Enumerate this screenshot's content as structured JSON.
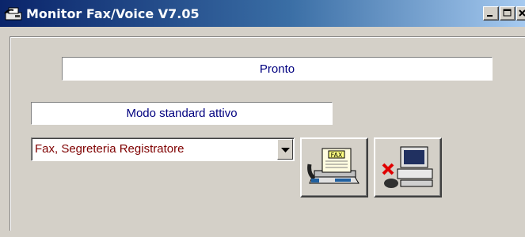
{
  "window": {
    "title": "Monitor Fax/Voice V7.05",
    "app_icon": "fax-phone-icon",
    "controls": [
      "minimize-icon",
      "maximize-icon",
      "close-icon"
    ]
  },
  "status": {
    "text": "Pronto"
  },
  "mode": {
    "text": "Modo standard attivo"
  },
  "mode_select": {
    "value": "Fax, Segreteria Registratore",
    "icon": "chevron-down-icon"
  },
  "buttons": {
    "fax": {
      "icon": "fax-machine-icon",
      "label": "FAX"
    },
    "pc": {
      "icon": "computer-disabled-icon"
    }
  },
  "colors": {
    "titlebar_start": "#0a246a",
    "titlebar_end": "#a6caf0",
    "status_text": "#00007f",
    "select_text": "#7f0000",
    "face": "#d4d0c8"
  }
}
